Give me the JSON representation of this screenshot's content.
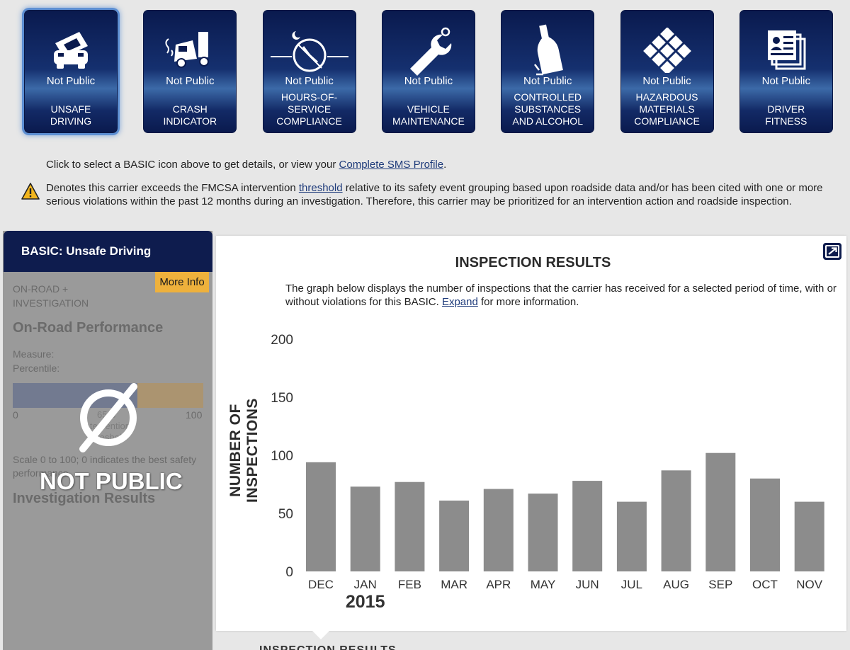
{
  "tiles": [
    {
      "id": "unsafe",
      "public": "Not Public",
      "label": "UNSAFE DRIVING",
      "label_lines": [
        "UNSAFE",
        "DRIVING"
      ],
      "icon": "car-icon",
      "selected": true
    },
    {
      "id": "crash",
      "public": "Not Public",
      "label": "CRASH INDICATOR",
      "label_lines": [
        "CRASH",
        "INDICATOR"
      ],
      "icon": "crashed-truck-icon",
      "selected": false
    },
    {
      "id": "hos",
      "public": "Not Public",
      "label": "HOURS-OF-SERVICE COMPLIANCE",
      "label_lines": [
        "HOURS-OF-",
        "SERVICE",
        "COMPLIANCE"
      ],
      "icon": "clock-gauge-icon",
      "selected": false
    },
    {
      "id": "vehicle",
      "public": "Not Public",
      "label": "VEHICLE MAINTENANCE",
      "label_lines": [
        "VEHICLE",
        "MAINTENANCE"
      ],
      "icon": "wrench-icon",
      "selected": false
    },
    {
      "id": "substances",
      "public": "Not Public",
      "label": "CONTROLLED SUBSTANCES AND ALCOHOL",
      "label_lines": [
        "CONTROLLED",
        "SUBSTANCES",
        "AND ALCOHOL"
      ],
      "icon": "bottle-icon",
      "selected": false
    },
    {
      "id": "hazmat",
      "public": "Not Public",
      "label": "HAZARDOUS MATERIALS COMPLIANCE",
      "label_lines": [
        "HAZARDOUS",
        "MATERIALS",
        "COMPLIANCE"
      ],
      "icon": "hazmat-diamond-icon",
      "selected": false
    },
    {
      "id": "fitness",
      "public": "Not Public",
      "label": "DRIVER FITNESS",
      "label_lines": [
        "DRIVER",
        "FITNESS"
      ],
      "icon": "driver-document-icon",
      "selected": false
    }
  ],
  "info": {
    "select_prefix": "Click to select a BASIC icon above to get details, or view your ",
    "sms_link": "Complete SMS Profile",
    "select_suffix": ".",
    "warning_prefix": "Denotes this carrier exceeds the FMCSA intervention ",
    "threshold_link": "threshold",
    "warning_suffix": " relative to its safety event grouping based upon roadside data and/or has been cited with one or more serious violations within the past 12 months during an investigation. Therefore, this carrier may be prioritized for an intervention action and roadside inspection."
  },
  "left_panel": {
    "header": "BASIC: Unsafe Driving",
    "more_info": "More Info",
    "type_line1": "ON-ROAD +",
    "type_line2": "INVESTIGATION",
    "performance_heading": "On-Road Performance",
    "measure_label": "Measure:",
    "percentile_label": "Percentile:",
    "scale_min": "0",
    "scale_max": "100",
    "threshold_pct": "65%",
    "threshold_line1": "Intervention",
    "threshold_line2": "Threshold",
    "scale_note": "Scale 0 to 100; 0 indicates the best safety performance",
    "investigation_heading": "Investigation Results",
    "overlay": "NOT PUBLIC"
  },
  "colors": {
    "tile_dark": "#0a1a4e",
    "header_navy": "#0e1c4e",
    "more_info_bg": "#eeb13c",
    "bar_color": "#8c8c8c",
    "percentile_bar": "#727a90",
    "threshold_bar": "#ab9470"
  },
  "chart_card": {
    "title": "INSPECTION RESULTS",
    "desc_prefix": "The graph below displays the number of inspections that the carrier has received for a selected period of time, with or without violations for this BASIC. ",
    "expand_link": "Expand",
    "desc_suffix": " for more information.",
    "expand_icon": "expand-icon",
    "below_title": "INSPECTION RESULTS"
  },
  "chart_data": {
    "type": "bar",
    "categories": [
      "DEC",
      "JAN",
      "FEB",
      "MAR",
      "APR",
      "MAY",
      "JUN",
      "JUL",
      "AUG",
      "SEP",
      "OCT",
      "NOV"
    ],
    "values": [
      94,
      73,
      77,
      61,
      71,
      67,
      78,
      60,
      87,
      102,
      80,
      60
    ],
    "year_label": "2015",
    "ylabel": "NUMBER OF INSPECTIONS",
    "ylim": [
      0,
      200
    ],
    "yticks": [
      0,
      50,
      100,
      150,
      200
    ],
    "grid": false
  }
}
